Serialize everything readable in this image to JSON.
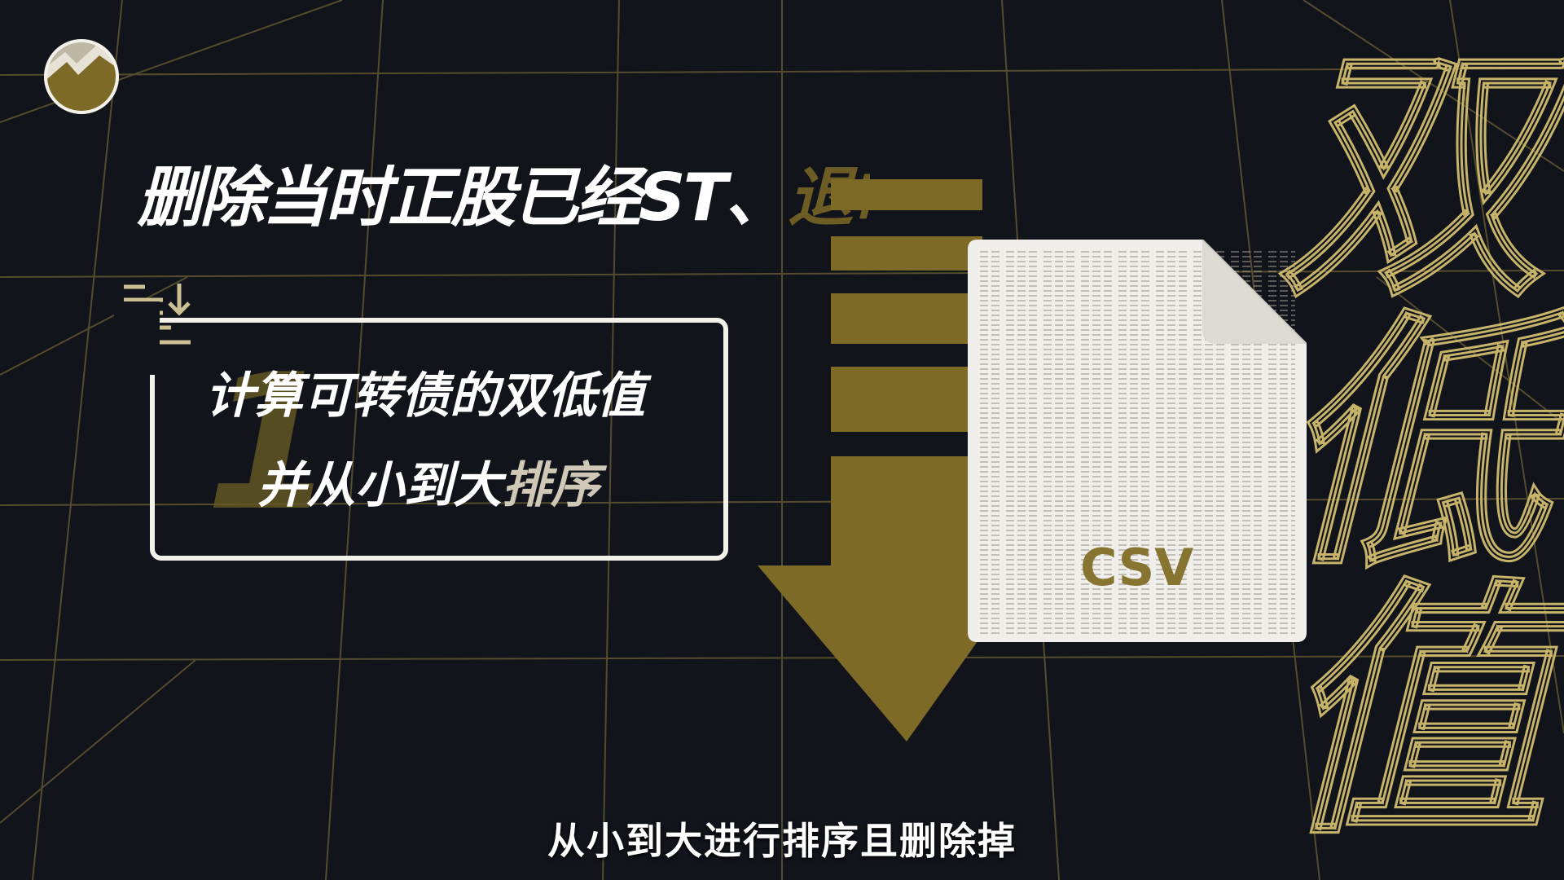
{
  "colors": {
    "background": "#12141c",
    "grid": "#8a7a3c",
    "gold": "#7d6a27",
    "white": "#ffffff"
  },
  "headline": {
    "main": "删除当时正股已经ST、",
    "faded": "退市"
  },
  "card": {
    "number": "1",
    "line1": "计算可转债的双低值",
    "line2_main": "并从小到大",
    "line2_accent": "排序"
  },
  "icons": {
    "logo": "logo-icon",
    "sort": "sort-descending-icon",
    "arrow": "down-arrow-icon",
    "file": "csv-file-icon"
  },
  "file": {
    "label": "CSV"
  },
  "big_title": {
    "text": "双低值"
  },
  "subtitle": "从小到大进行排序且删除掉"
}
